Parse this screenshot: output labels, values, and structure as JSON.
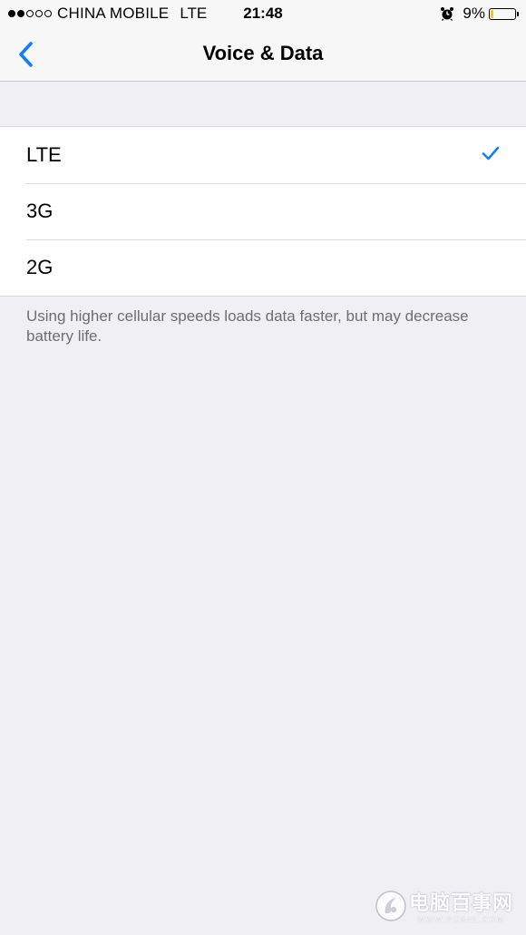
{
  "status_bar": {
    "signal_filled": 2,
    "signal_total": 5,
    "carrier": "CHINA MOBILE",
    "network": "LTE",
    "time": "21:48",
    "battery_percent": "9%",
    "battery_level": 0.09,
    "battery_color": "#f7c600"
  },
  "nav": {
    "title": "Voice & Data",
    "back_icon": "chevron-left-icon",
    "accent_color": "#157efb"
  },
  "options": [
    {
      "label": "LTE",
      "selected": true
    },
    {
      "label": "3G",
      "selected": false
    },
    {
      "label": "2G",
      "selected": false
    }
  ],
  "footer_note": "Using higher cellular speeds loads data faster, but may decrease battery life.",
  "watermark": {
    "name": "电脑百事网",
    "site": "WWW.PC841.COM"
  }
}
